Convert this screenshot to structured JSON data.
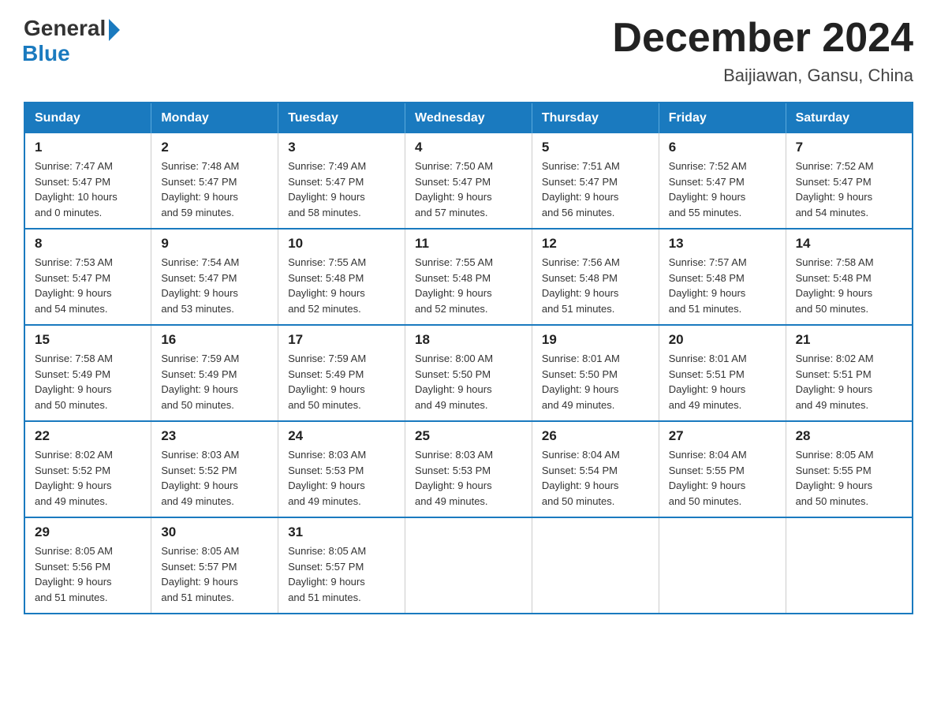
{
  "logo": {
    "general": "General",
    "blue": "Blue"
  },
  "title": "December 2024",
  "location": "Baijiawan, Gansu, China",
  "days_of_week": [
    "Sunday",
    "Monday",
    "Tuesday",
    "Wednesday",
    "Thursday",
    "Friday",
    "Saturday"
  ],
  "weeks": [
    [
      {
        "day": "1",
        "sunrise": "7:47 AM",
        "sunset": "5:47 PM",
        "daylight": "10 hours and 0 minutes."
      },
      {
        "day": "2",
        "sunrise": "7:48 AM",
        "sunset": "5:47 PM",
        "daylight": "9 hours and 59 minutes."
      },
      {
        "day": "3",
        "sunrise": "7:49 AM",
        "sunset": "5:47 PM",
        "daylight": "9 hours and 58 minutes."
      },
      {
        "day": "4",
        "sunrise": "7:50 AM",
        "sunset": "5:47 PM",
        "daylight": "9 hours and 57 minutes."
      },
      {
        "day": "5",
        "sunrise": "7:51 AM",
        "sunset": "5:47 PM",
        "daylight": "9 hours and 56 minutes."
      },
      {
        "day": "6",
        "sunrise": "7:52 AM",
        "sunset": "5:47 PM",
        "daylight": "9 hours and 55 minutes."
      },
      {
        "day": "7",
        "sunrise": "7:52 AM",
        "sunset": "5:47 PM",
        "daylight": "9 hours and 54 minutes."
      }
    ],
    [
      {
        "day": "8",
        "sunrise": "7:53 AM",
        "sunset": "5:47 PM",
        "daylight": "9 hours and 54 minutes."
      },
      {
        "day": "9",
        "sunrise": "7:54 AM",
        "sunset": "5:47 PM",
        "daylight": "9 hours and 53 minutes."
      },
      {
        "day": "10",
        "sunrise": "7:55 AM",
        "sunset": "5:48 PM",
        "daylight": "9 hours and 52 minutes."
      },
      {
        "day": "11",
        "sunrise": "7:55 AM",
        "sunset": "5:48 PM",
        "daylight": "9 hours and 52 minutes."
      },
      {
        "day": "12",
        "sunrise": "7:56 AM",
        "sunset": "5:48 PM",
        "daylight": "9 hours and 51 minutes."
      },
      {
        "day": "13",
        "sunrise": "7:57 AM",
        "sunset": "5:48 PM",
        "daylight": "9 hours and 51 minutes."
      },
      {
        "day": "14",
        "sunrise": "7:58 AM",
        "sunset": "5:48 PM",
        "daylight": "9 hours and 50 minutes."
      }
    ],
    [
      {
        "day": "15",
        "sunrise": "7:58 AM",
        "sunset": "5:49 PM",
        "daylight": "9 hours and 50 minutes."
      },
      {
        "day": "16",
        "sunrise": "7:59 AM",
        "sunset": "5:49 PM",
        "daylight": "9 hours and 50 minutes."
      },
      {
        "day": "17",
        "sunrise": "7:59 AM",
        "sunset": "5:49 PM",
        "daylight": "9 hours and 50 minutes."
      },
      {
        "day": "18",
        "sunrise": "8:00 AM",
        "sunset": "5:50 PM",
        "daylight": "9 hours and 49 minutes."
      },
      {
        "day": "19",
        "sunrise": "8:01 AM",
        "sunset": "5:50 PM",
        "daylight": "9 hours and 49 minutes."
      },
      {
        "day": "20",
        "sunrise": "8:01 AM",
        "sunset": "5:51 PM",
        "daylight": "9 hours and 49 minutes."
      },
      {
        "day": "21",
        "sunrise": "8:02 AM",
        "sunset": "5:51 PM",
        "daylight": "9 hours and 49 minutes."
      }
    ],
    [
      {
        "day": "22",
        "sunrise": "8:02 AM",
        "sunset": "5:52 PM",
        "daylight": "9 hours and 49 minutes."
      },
      {
        "day": "23",
        "sunrise": "8:03 AM",
        "sunset": "5:52 PM",
        "daylight": "9 hours and 49 minutes."
      },
      {
        "day": "24",
        "sunrise": "8:03 AM",
        "sunset": "5:53 PM",
        "daylight": "9 hours and 49 minutes."
      },
      {
        "day": "25",
        "sunrise": "8:03 AM",
        "sunset": "5:53 PM",
        "daylight": "9 hours and 49 minutes."
      },
      {
        "day": "26",
        "sunrise": "8:04 AM",
        "sunset": "5:54 PM",
        "daylight": "9 hours and 50 minutes."
      },
      {
        "day": "27",
        "sunrise": "8:04 AM",
        "sunset": "5:55 PM",
        "daylight": "9 hours and 50 minutes."
      },
      {
        "day": "28",
        "sunrise": "8:05 AM",
        "sunset": "5:55 PM",
        "daylight": "9 hours and 50 minutes."
      }
    ],
    [
      {
        "day": "29",
        "sunrise": "8:05 AM",
        "sunset": "5:56 PM",
        "daylight": "9 hours and 51 minutes."
      },
      {
        "day": "30",
        "sunrise": "8:05 AM",
        "sunset": "5:57 PM",
        "daylight": "9 hours and 51 minutes."
      },
      {
        "day": "31",
        "sunrise": "8:05 AM",
        "sunset": "5:57 PM",
        "daylight": "9 hours and 51 minutes."
      },
      null,
      null,
      null,
      null
    ]
  ],
  "labels": {
    "sunrise": "Sunrise:",
    "sunset": "Sunset:",
    "daylight": "Daylight:"
  }
}
